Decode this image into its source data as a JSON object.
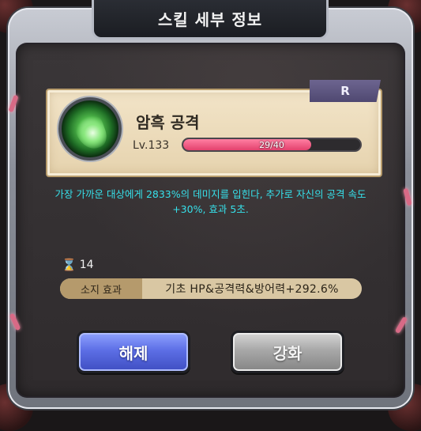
{
  "window": {
    "title": "스킬 세부 정보"
  },
  "skill": {
    "name": "암흑 공격",
    "rank": "R",
    "level_label": "Lv.133",
    "progress_text": "29/40",
    "progress_fraction": 0.725,
    "icon": "dark-attack-skill-icon",
    "description": "가장 가까운 대상에게 2833%의 데미지를 입힌다, 추가로 자신의 공격 속도+30%, 효과 5초."
  },
  "cooldown": {
    "icon": "hourglass-icon",
    "value": "14"
  },
  "passive": {
    "label": "소지 효과",
    "value": "기초 HP&공격력&방어력+292.6%"
  },
  "buttons": {
    "release_label": "해제",
    "upgrade_label": "강화"
  },
  "colors": {
    "accent_text": "#36e0ea",
    "progress_fill": "#e3416d",
    "release_button": "#5d6fe6",
    "upgrade_button": "#a8a8a8",
    "rank_tag": "#5b5480"
  }
}
